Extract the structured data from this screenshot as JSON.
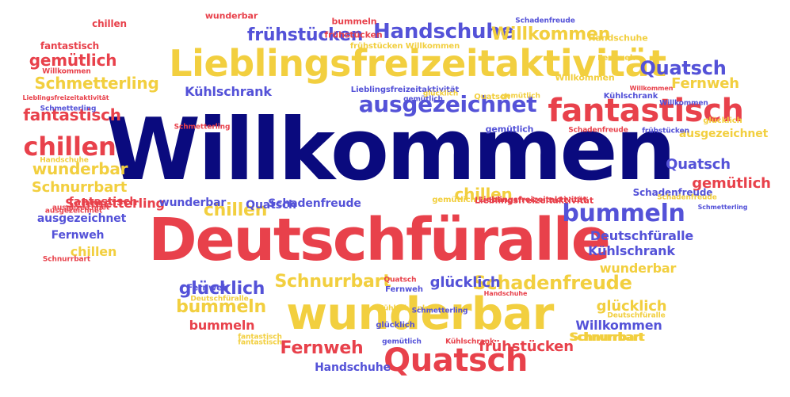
{
  "palette": {
    "navy": "#0a0a7e",
    "red": "#e8414b",
    "yellow": "#f2cf3f",
    "blue": "#5452d8"
  },
  "words": [
    {
      "text": "Willkommen",
      "color": "navy",
      "size": 108
    },
    {
      "text": "Deutschfüralle",
      "color": "red",
      "size": 74
    },
    {
      "text": "Lieblingsfreizeitaktivität",
      "color": "yellow",
      "size": 46
    },
    {
      "text": "wunderbar",
      "color": "yellow",
      "size": 56
    },
    {
      "text": "fantastisch",
      "color": "red",
      "size": 40
    },
    {
      "text": "ausgezeichnet",
      "color": "blue",
      "size": 28
    },
    {
      "text": "Handschuhe",
      "color": "blue",
      "size": 26
    },
    {
      "text": "frühstücken",
      "color": "blue",
      "size": 22
    },
    {
      "text": "Quatsch",
      "color": "red",
      "size": 40
    },
    {
      "text": "Fernweh",
      "color": "red",
      "size": 22
    },
    {
      "text": "bummeln",
      "color": "blue",
      "size": 30
    },
    {
      "text": "Quatsch",
      "color": "blue",
      "size": 24
    },
    {
      "text": "chillen",
      "color": "red",
      "size": 32
    },
    {
      "text": "gemütlich",
      "color": "red",
      "size": 20
    },
    {
      "text": "fantastisch",
      "color": "red",
      "size": 20
    },
    {
      "text": "Schmetterling",
      "color": "yellow",
      "size": 20
    },
    {
      "text": "wunderbar",
      "color": "yellow",
      "size": 20
    },
    {
      "text": "Schnurrbart",
      "color": "yellow",
      "size": 18
    },
    {
      "text": "glücklich",
      "color": "blue",
      "size": 22
    },
    {
      "text": "bummeln",
      "color": "yellow",
      "size": 22
    },
    {
      "text": "Schnurrbart",
      "color": "yellow",
      "size": 22
    },
    {
      "text": "Schadenfreude",
      "color": "yellow",
      "size": 24
    },
    {
      "text": "glücklich",
      "color": "blue",
      "size": 18
    },
    {
      "text": "chillen",
      "color": "yellow",
      "size": 22
    },
    {
      "text": "Willkommen",
      "color": "yellow",
      "size": 22
    },
    {
      "text": "Quatsch",
      "color": "blue",
      "size": 18
    },
    {
      "text": "Fernweh",
      "color": "yellow",
      "size": 18
    },
    {
      "text": "Kühlschrank",
      "color": "blue",
      "size": 16
    },
    {
      "text": "Deutschfüralle",
      "color": "blue",
      "size": 16
    },
    {
      "text": "Kühlschrank",
      "color": "blue",
      "size": 16
    },
    {
      "text": "wunderbar",
      "color": "yellow",
      "size": 16
    },
    {
      "text": "glücklich",
      "color": "yellow",
      "size": 18
    },
    {
      "text": "Willkommen",
      "color": "blue",
      "size": 16
    },
    {
      "text": "frühstücken",
      "color": "red",
      "size": 18
    },
    {
      "text": "Handschuhe",
      "color": "blue",
      "size": 14
    },
    {
      "text": "Schnurrbart",
      "color": "yellow",
      "size": 14
    },
    {
      "text": "bummeln",
      "color": "red",
      "size": 16
    },
    {
      "text": "fantastisch",
      "color": "red",
      "size": 14
    },
    {
      "text": "Schmetterling",
      "color": "red",
      "size": 16
    },
    {
      "text": "wunderbar",
      "color": "blue",
      "size": 14
    },
    {
      "text": "Schadenfreude",
      "color": "blue",
      "size": 14
    },
    {
      "text": "chillen",
      "color": "yellow",
      "size": 20
    },
    {
      "text": "ausgezeichnet",
      "color": "blue",
      "size": 14
    },
    {
      "text": "Fernweh",
      "color": "blue",
      "size": 14
    },
    {
      "text": "chillen",
      "color": "yellow",
      "size": 16
    },
    {
      "text": "gemütlich",
      "color": "red",
      "size": 18
    },
    {
      "text": "Quatsch",
      "color": "blue",
      "size": 14
    },
    {
      "text": "ausgezeichnet",
      "color": "yellow",
      "size": 14
    },
    {
      "text": "chillen",
      "color": "red",
      "size": 12
    },
    {
      "text": "bummeln",
      "color": "red",
      "size": 11
    },
    {
      "text": "wunderbar",
      "color": "red",
      "size": 11
    },
    {
      "text": "Willkommen",
      "color": "yellow",
      "size": 11
    },
    {
      "text": "Schadenfreude",
      "color": "blue",
      "size": 9
    },
    {
      "text": "Handschuhe",
      "color": "yellow",
      "size": 11
    },
    {
      "text": "Fernweh",
      "color": "yellow",
      "size": 10
    },
    {
      "text": "frühstücken",
      "color": "red",
      "size": 11
    },
    {
      "text": "frühstücken Willkommen",
      "color": "yellow",
      "size": 10
    },
    {
      "text": "fantastisch",
      "color": "red",
      "size": 12
    },
    {
      "text": "Willkommen",
      "color": "red",
      "size": 9
    },
    {
      "text": "Fernweh",
      "color": "blue",
      "size": 11
    },
    {
      "text": "Lieblingsfreizeitaktivität",
      "color": "blue",
      "size": 10
    },
    {
      "text": "Lieblingsfreizeitaktivität",
      "color": "red",
      "size": 8
    },
    {
      "text": "Kühlschrank",
      "color": "blue",
      "size": 10
    },
    {
      "text": "Quatsch",
      "color": "yellow",
      "size": 10
    },
    {
      "text": "Schmetterling",
      "color": "red",
      "size": 9
    },
    {
      "text": "glücklich",
      "color": "yellow",
      "size": 10
    },
    {
      "text": "gemütlich",
      "color": "blue",
      "size": 11
    },
    {
      "text": "frühstücken",
      "color": "blue",
      "size": 9
    },
    {
      "text": "Schadenfreude",
      "color": "red",
      "size": 9
    },
    {
      "text": "Schadenfreude",
      "color": "blue",
      "size": 12
    },
    {
      "text": "gemütlich",
      "color": "yellow",
      "size": 10
    },
    {
      "text": "Lieblingsfreizeitaktivität",
      "color": "red",
      "size": 11
    },
    {
      "text": "Handschuhe",
      "color": "yellow",
      "size": 9
    },
    {
      "text": "Lieblingsfreizeitaktivität",
      "color": "red",
      "size": 10
    },
    {
      "text": "Schmetterling",
      "color": "blue",
      "size": 8
    },
    {
      "text": "Schnurrbart",
      "color": "red",
      "size": 9
    },
    {
      "text": "Deutschfüralle",
      "color": "yellow",
      "size": 9
    },
    {
      "text": "Kühlschrank",
      "color": "yellow",
      "size": 9
    },
    {
      "text": "Schmetterling",
      "color": "blue",
      "size": 9
    },
    {
      "text": "Quatsch",
      "color": "red",
      "size": 9
    },
    {
      "text": "Fernweh",
      "color": "blue",
      "size": 10
    },
    {
      "text": "glücklich",
      "color": "blue",
      "size": 10
    },
    {
      "text": "Handschuhe",
      "color": "red",
      "size": 8
    },
    {
      "text": "Deutschfüralle",
      "color": "yellow",
      "size": 9
    },
    {
      "text": "gemütlich",
      "color": "blue",
      "size": 9
    },
    {
      "text": "Kühlschrank",
      "color": "red",
      "size": 9
    },
    {
      "text": "fantastisch",
      "color": "yellow",
      "size": 9
    },
    {
      "text": "Schnurrbart",
      "color": "yellow",
      "size": 14
    },
    {
      "text": "ausgezeichnet",
      "color": "red",
      "size": 9
    },
    {
      "text": "Willkommen",
      "color": "blue",
      "size": 9
    },
    {
      "text": "fantastisch",
      "color": "yellow",
      "size": 9
    },
    {
      "text": "gemütlich",
      "color": "blue",
      "size": 9
    },
    {
      "text": "Schmetterling",
      "color": "blue",
      "size": 9
    },
    {
      "text": "glücklich",
      "color": "yellow",
      "size": 9
    },
    {
      "text": "Willkommen",
      "color": "red",
      "size": 8
    },
    {
      "text": "Schadenfreude",
      "color": "yellow",
      "size": 9
    },
    {
      "text": "ausgezeichnet",
      "color": "red",
      "size": 9
    },
    {
      "text": "gemütlich",
      "color": "yellow",
      "size": 9
    }
  ]
}
